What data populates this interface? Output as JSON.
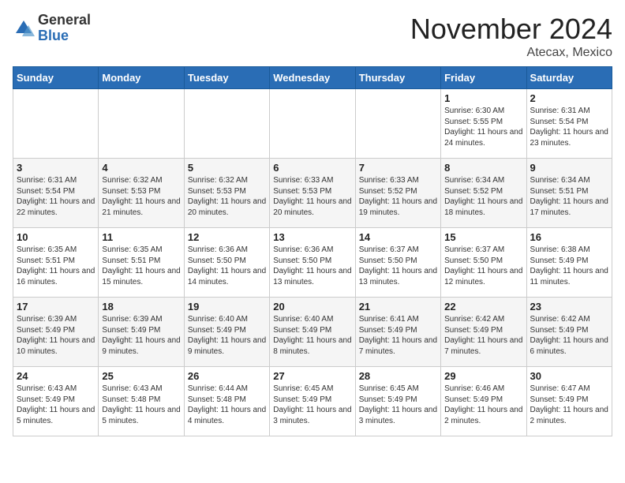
{
  "header": {
    "logo_general": "General",
    "logo_blue": "Blue",
    "month_title": "November 2024",
    "location": "Atecax, Mexico"
  },
  "weekdays": [
    "Sunday",
    "Monday",
    "Tuesday",
    "Wednesday",
    "Thursday",
    "Friday",
    "Saturday"
  ],
  "weeks": [
    [
      {
        "day": "",
        "info": ""
      },
      {
        "day": "",
        "info": ""
      },
      {
        "day": "",
        "info": ""
      },
      {
        "day": "",
        "info": ""
      },
      {
        "day": "",
        "info": ""
      },
      {
        "day": "1",
        "info": "Sunrise: 6:30 AM\nSunset: 5:55 PM\nDaylight: 11 hours and 24 minutes."
      },
      {
        "day": "2",
        "info": "Sunrise: 6:31 AM\nSunset: 5:54 PM\nDaylight: 11 hours and 23 minutes."
      }
    ],
    [
      {
        "day": "3",
        "info": "Sunrise: 6:31 AM\nSunset: 5:54 PM\nDaylight: 11 hours and 22 minutes."
      },
      {
        "day": "4",
        "info": "Sunrise: 6:32 AM\nSunset: 5:53 PM\nDaylight: 11 hours and 21 minutes."
      },
      {
        "day": "5",
        "info": "Sunrise: 6:32 AM\nSunset: 5:53 PM\nDaylight: 11 hours and 20 minutes."
      },
      {
        "day": "6",
        "info": "Sunrise: 6:33 AM\nSunset: 5:53 PM\nDaylight: 11 hours and 20 minutes."
      },
      {
        "day": "7",
        "info": "Sunrise: 6:33 AM\nSunset: 5:52 PM\nDaylight: 11 hours and 19 minutes."
      },
      {
        "day": "8",
        "info": "Sunrise: 6:34 AM\nSunset: 5:52 PM\nDaylight: 11 hours and 18 minutes."
      },
      {
        "day": "9",
        "info": "Sunrise: 6:34 AM\nSunset: 5:51 PM\nDaylight: 11 hours and 17 minutes."
      }
    ],
    [
      {
        "day": "10",
        "info": "Sunrise: 6:35 AM\nSunset: 5:51 PM\nDaylight: 11 hours and 16 minutes."
      },
      {
        "day": "11",
        "info": "Sunrise: 6:35 AM\nSunset: 5:51 PM\nDaylight: 11 hours and 15 minutes."
      },
      {
        "day": "12",
        "info": "Sunrise: 6:36 AM\nSunset: 5:50 PM\nDaylight: 11 hours and 14 minutes."
      },
      {
        "day": "13",
        "info": "Sunrise: 6:36 AM\nSunset: 5:50 PM\nDaylight: 11 hours and 13 minutes."
      },
      {
        "day": "14",
        "info": "Sunrise: 6:37 AM\nSunset: 5:50 PM\nDaylight: 11 hours and 13 minutes."
      },
      {
        "day": "15",
        "info": "Sunrise: 6:37 AM\nSunset: 5:50 PM\nDaylight: 11 hours and 12 minutes."
      },
      {
        "day": "16",
        "info": "Sunrise: 6:38 AM\nSunset: 5:49 PM\nDaylight: 11 hours and 11 minutes."
      }
    ],
    [
      {
        "day": "17",
        "info": "Sunrise: 6:39 AM\nSunset: 5:49 PM\nDaylight: 11 hours and 10 minutes."
      },
      {
        "day": "18",
        "info": "Sunrise: 6:39 AM\nSunset: 5:49 PM\nDaylight: 11 hours and 9 minutes."
      },
      {
        "day": "19",
        "info": "Sunrise: 6:40 AM\nSunset: 5:49 PM\nDaylight: 11 hours and 9 minutes."
      },
      {
        "day": "20",
        "info": "Sunrise: 6:40 AM\nSunset: 5:49 PM\nDaylight: 11 hours and 8 minutes."
      },
      {
        "day": "21",
        "info": "Sunrise: 6:41 AM\nSunset: 5:49 PM\nDaylight: 11 hours and 7 minutes."
      },
      {
        "day": "22",
        "info": "Sunrise: 6:42 AM\nSunset: 5:49 PM\nDaylight: 11 hours and 7 minutes."
      },
      {
        "day": "23",
        "info": "Sunrise: 6:42 AM\nSunset: 5:49 PM\nDaylight: 11 hours and 6 minutes."
      }
    ],
    [
      {
        "day": "24",
        "info": "Sunrise: 6:43 AM\nSunset: 5:49 PM\nDaylight: 11 hours and 5 minutes."
      },
      {
        "day": "25",
        "info": "Sunrise: 6:43 AM\nSunset: 5:48 PM\nDaylight: 11 hours and 5 minutes."
      },
      {
        "day": "26",
        "info": "Sunrise: 6:44 AM\nSunset: 5:48 PM\nDaylight: 11 hours and 4 minutes."
      },
      {
        "day": "27",
        "info": "Sunrise: 6:45 AM\nSunset: 5:49 PM\nDaylight: 11 hours and 3 minutes."
      },
      {
        "day": "28",
        "info": "Sunrise: 6:45 AM\nSunset: 5:49 PM\nDaylight: 11 hours and 3 minutes."
      },
      {
        "day": "29",
        "info": "Sunrise: 6:46 AM\nSunset: 5:49 PM\nDaylight: 11 hours and 2 minutes."
      },
      {
        "day": "30",
        "info": "Sunrise: 6:47 AM\nSunset: 5:49 PM\nDaylight: 11 hours and 2 minutes."
      }
    ]
  ]
}
